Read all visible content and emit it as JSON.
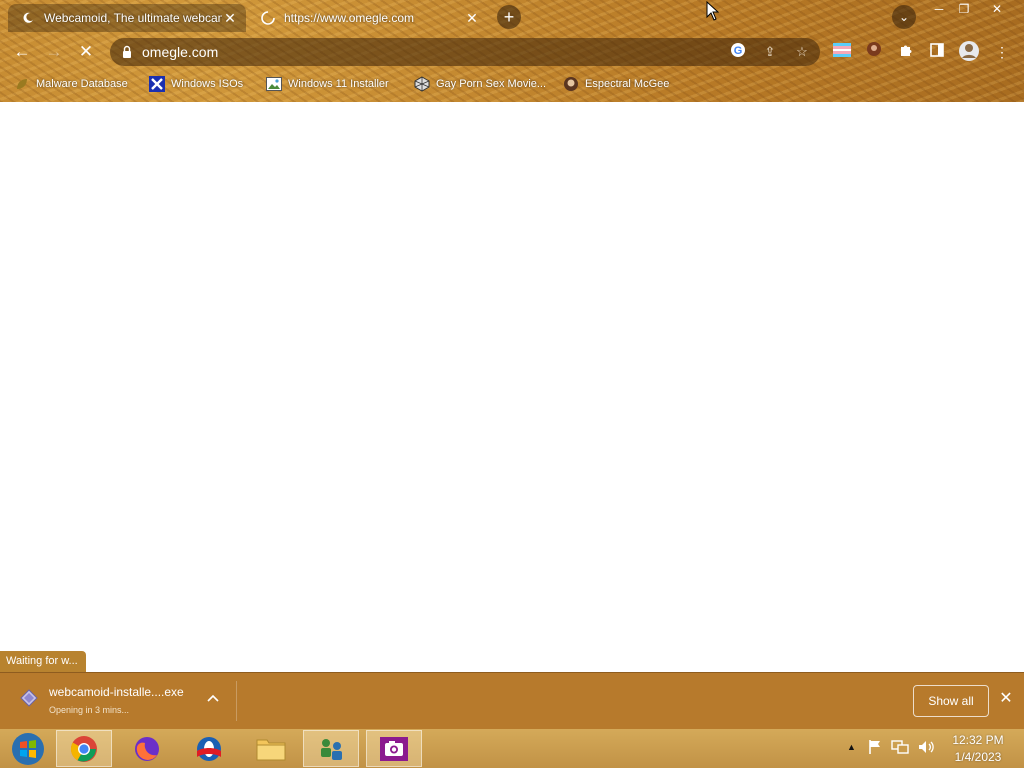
{
  "browser": {
    "tabs": [
      {
        "title": "Webcamoid, The ultimate webcam",
        "icon": "moon-icon",
        "active": true
      },
      {
        "title": "https://www.omegle.com",
        "icon": "loading-spinner-icon",
        "active": false
      }
    ],
    "address": {
      "url": "omegle.com"
    },
    "bookmarks": [
      {
        "label": "Malware Database",
        "icon": "leaf-icon"
      },
      {
        "label": "Windows ISOs",
        "icon": "x-logo-icon"
      },
      {
        "label": "Windows 11 Installer",
        "icon": "image-icon"
      },
      {
        "label": "Gay Porn Sex Movie...",
        "icon": "cube-icon"
      },
      {
        "label": "Espectral McGee",
        "icon": "avatar-icon"
      }
    ],
    "status_text": "Waiting for w..."
  },
  "download": {
    "filename": "webcamoid-installe....exe",
    "status": "Opening in 3 mins...",
    "show_all_label": "Show all"
  },
  "taskbar": {
    "items": [
      "start-orb",
      "chrome",
      "firefox",
      "opera",
      "file-explorer",
      "network-app",
      "camera-app"
    ],
    "clock": {
      "time": "12:32 PM",
      "date": "1/4/2023"
    }
  },
  "colors": {
    "chrome_bg": "#b87a26",
    "shelf_bg": "#b77a2c",
    "taskbar_bg": "#c99a4a"
  }
}
